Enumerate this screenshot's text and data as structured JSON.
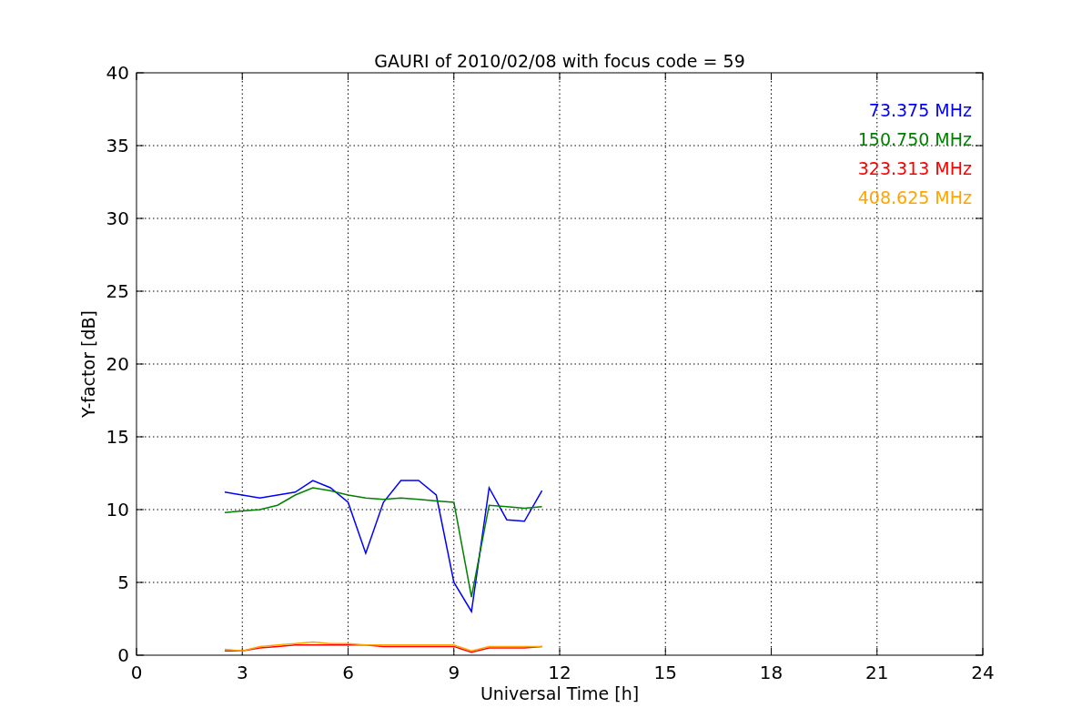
{
  "chart_data": {
    "type": "line",
    "title": "GAURI of 2010/02/08 with focus code = 59",
    "xlabel": "Universal Time [h]",
    "ylabel": "Y-factor [dB]",
    "x": [
      2.5,
      3,
      3.5,
      4,
      4.5,
      5,
      5.5,
      6,
      6.5,
      7,
      7.5,
      8,
      8.5,
      9,
      9.5,
      10,
      10.5,
      11,
      11.5
    ],
    "series": [
      {
        "name": "73.375 MHz",
        "color": "#0000ff",
        "values": [
          11.2,
          11,
          10.8,
          11,
          11.2,
          12,
          11.5,
          10.5,
          7,
          10.5,
          12,
          12,
          11,
          5,
          3,
          11.5,
          9.3,
          9.2,
          11.3
        ]
      },
      {
        "name": "150.750 MHz",
        "color": "#008000",
        "values": [
          9.8,
          9.9,
          10,
          10.3,
          11,
          11.5,
          11.3,
          11,
          10.8,
          10.7,
          10.8,
          10.7,
          10.6,
          10.5,
          4,
          10.3,
          10.2,
          10.1,
          10.2
        ]
      },
      {
        "name": "323.313 MHz",
        "color": "#ff0000",
        "values": [
          0.3,
          0.3,
          0.5,
          0.6,
          0.7,
          0.7,
          0.7,
          0.7,
          0.7,
          0.6,
          0.6,
          0.6,
          0.6,
          0.6,
          0.2,
          0.5,
          0.5,
          0.5,
          0.6
        ]
      },
      {
        "name": "408.625 MHz",
        "color": "#ffa500",
        "values": [
          0.4,
          0.3,
          0.6,
          0.7,
          0.8,
          0.9,
          0.8,
          0.8,
          0.7,
          0.7,
          0.7,
          0.7,
          0.7,
          0.7,
          0.3,
          0.6,
          0.6,
          0.6,
          0.6
        ]
      }
    ],
    "xlim": [
      0,
      24
    ],
    "ylim": [
      0,
      40
    ],
    "xticks": [
      0,
      3,
      6,
      9,
      12,
      15,
      18,
      21,
      24
    ],
    "yticks": [
      0,
      5,
      10,
      15,
      20,
      25,
      30,
      35,
      40
    ],
    "grid": true
  }
}
